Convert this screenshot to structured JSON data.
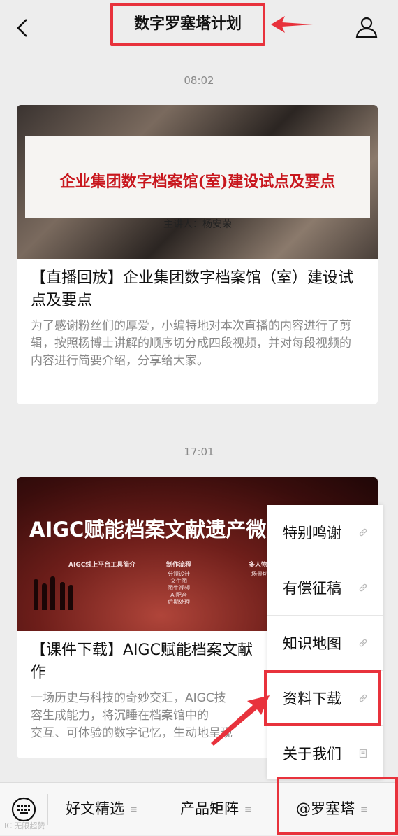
{
  "header": {
    "title": "数字罗塞塔计划",
    "icons": {
      "back": "chevron-left-icon",
      "profile": "user-icon"
    }
  },
  "messages": [
    {
      "timestamp": "08:02",
      "cover": {
        "heading": "企业集团数字档案馆(室)建设试点及要点",
        "speaker": "主讲人：杨安荣"
      },
      "title": "【直播回放】企业集团数字档案馆（室）建设试点及要点",
      "description": "为了感谢粉丝们的厚爱，小编特地对本次直播的内容进行了剪辑，按照杨博士讲解的顺序切分成四段视频，并对每段视频的内容进行简要介绍，分享给大家。"
    },
    {
      "timestamp": "17:01",
      "cover": {
        "heading": "AIGC赋能档案文献遗产微",
        "sub1": "AIGC线上平台工具简介",
        "sub2": "制作流程",
        "sub3": "多人物",
        "list2": [
          "分镜设计",
          "文生图",
          "图生视频",
          "AI配音",
          "后期处理"
        ],
        "list3": [
          "场景切"
        ]
      },
      "title": "【课件下载】AIGC赋能档案文献",
      "title_line2": "作",
      "description_lines": [
        "一场历史与科技的奇妙交汇，AIGC技",
        "容生成能力，将沉睡在档案馆中的",
        "交互、可体验的数字记忆，生动地呈现"
      ]
    }
  ],
  "popup_menu": {
    "items": [
      {
        "label": "特别鸣谢",
        "icon": "link-icon"
      },
      {
        "label": "有偿征稿",
        "icon": "link-icon"
      },
      {
        "label": "知识地图",
        "icon": "link-icon"
      },
      {
        "label": "资料下载",
        "icon": "link-icon"
      },
      {
        "label": "关于我们",
        "icon": "document-icon"
      }
    ]
  },
  "bottom_menu": {
    "keyboard_icon": "keyboard-icon",
    "tabs": [
      {
        "label": "好文精选"
      },
      {
        "label": "产品矩阵"
      },
      {
        "label": "@罗塞塔"
      }
    ]
  },
  "watermark": "IC 无限超赞",
  "annotation_color": "#e8323c"
}
